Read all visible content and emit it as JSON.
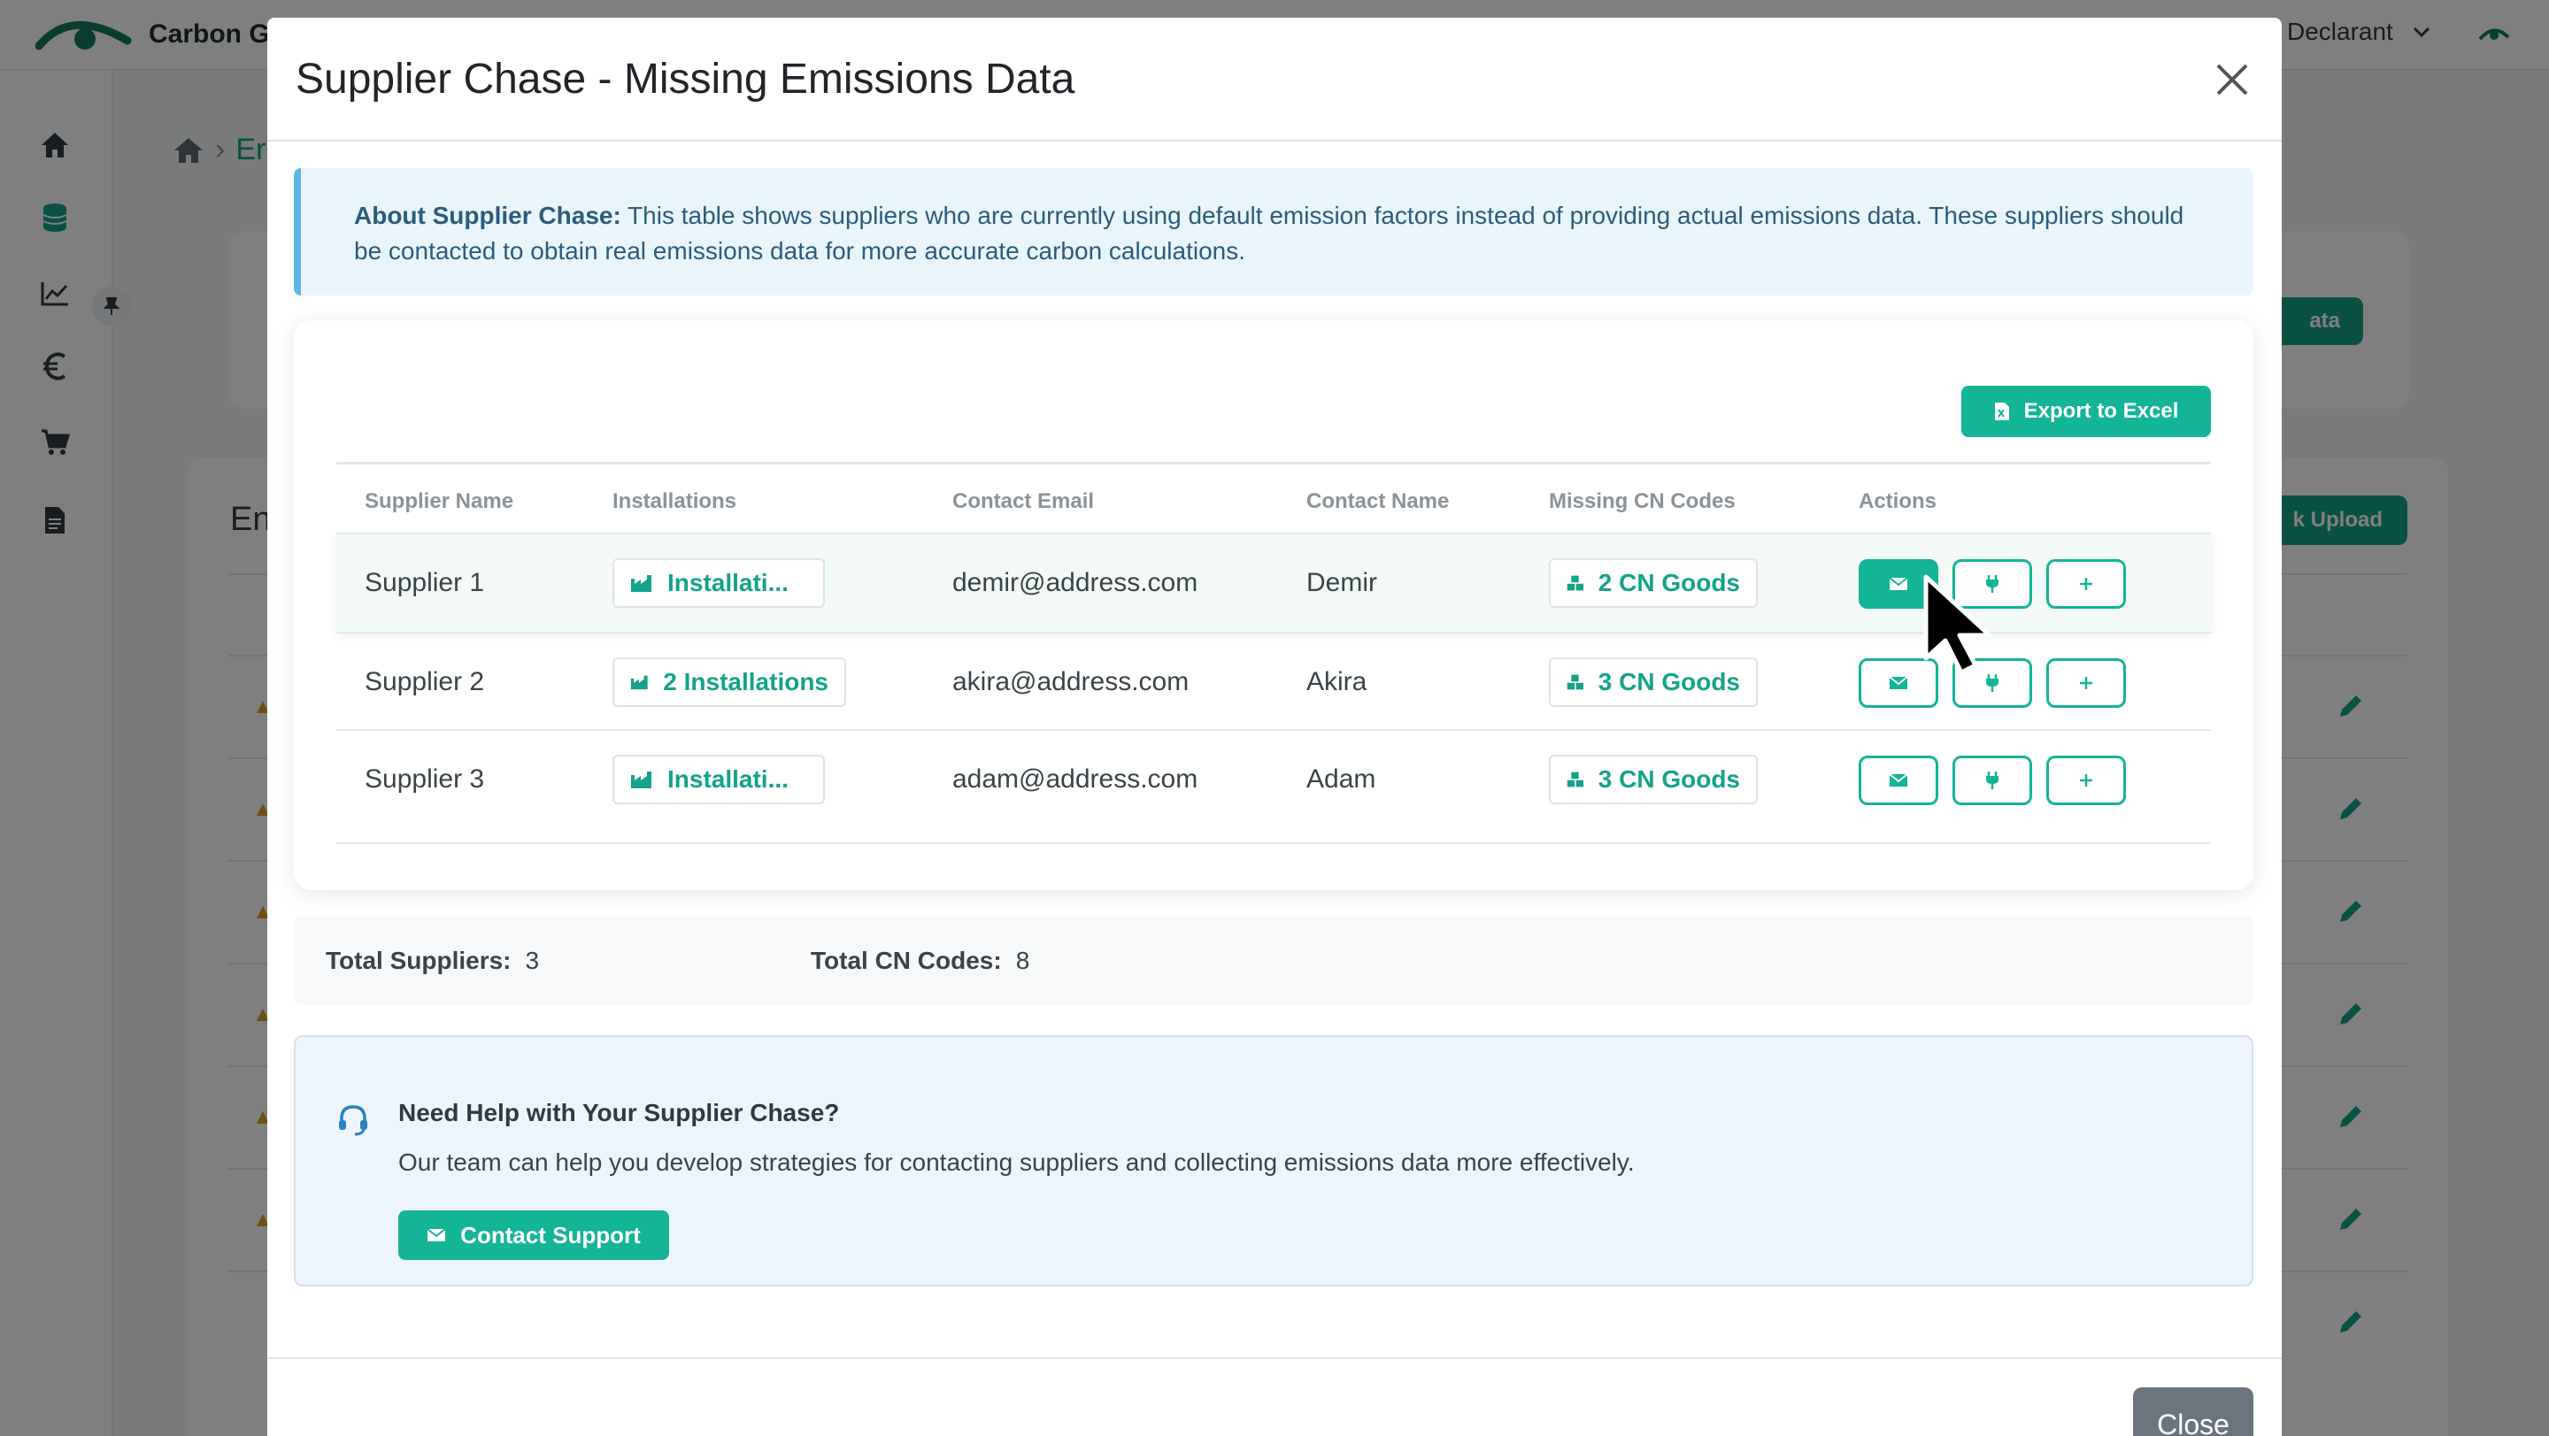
{
  "app": {
    "brand": "Carbon G",
    "user_label": "l Declarant",
    "breadcrumb_tail": "Er",
    "bg_button_1": "ata",
    "bg_title": "En",
    "bg_button_2": "k Upload",
    "accent_color": "#14b497"
  },
  "modal": {
    "title": "Supplier Chase - Missing Emissions Data",
    "info_label": "About Supplier Chase:",
    "info_text": " This table shows suppliers who are currently using default emission factors instead of providing actual emissions data. These suppliers should be contacted to obtain real emissions data for more accurate carbon calculations.",
    "export_label": "Export to Excel",
    "columns": [
      "Supplier Name",
      "Installations",
      "Contact Email",
      "Contact Name",
      "Missing CN Codes",
      "Actions"
    ],
    "rows": [
      {
        "supplier": "Supplier 1",
        "installations": "Installati...",
        "email": "demir@address.com",
        "contact": "Demir",
        "cn_goods": "2 CN Goods"
      },
      {
        "supplier": "Supplier 2",
        "installations": "2 Installations",
        "email": "akira@address.com",
        "contact": "Akira",
        "cn_goods": "3 CN Goods"
      },
      {
        "supplier": "Supplier 3",
        "installations": "Installati...",
        "email": "adam@address.com",
        "contact": "Adam",
        "cn_goods": "3 CN Goods"
      }
    ],
    "totals": {
      "suppliers_label": "Total Suppliers:",
      "suppliers_value": "3",
      "cn_label": "Total CN Codes:",
      "cn_value": "8"
    },
    "help": {
      "title": "Need Help with Your Supplier Chase?",
      "text": "Our team can help you develop strategies for contacting suppliers and collecting emissions data more effectively.",
      "button": "Contact Support"
    },
    "close_label": "Close",
    "icons": {
      "close": "close-icon",
      "excel": "excel-file-icon",
      "installation": "factory-icon",
      "cn_goods": "boxes-icon",
      "email_action": "envelope-icon",
      "plug_action": "plug-icon",
      "add_action": "plus-icon",
      "help": "headset-icon"
    }
  }
}
